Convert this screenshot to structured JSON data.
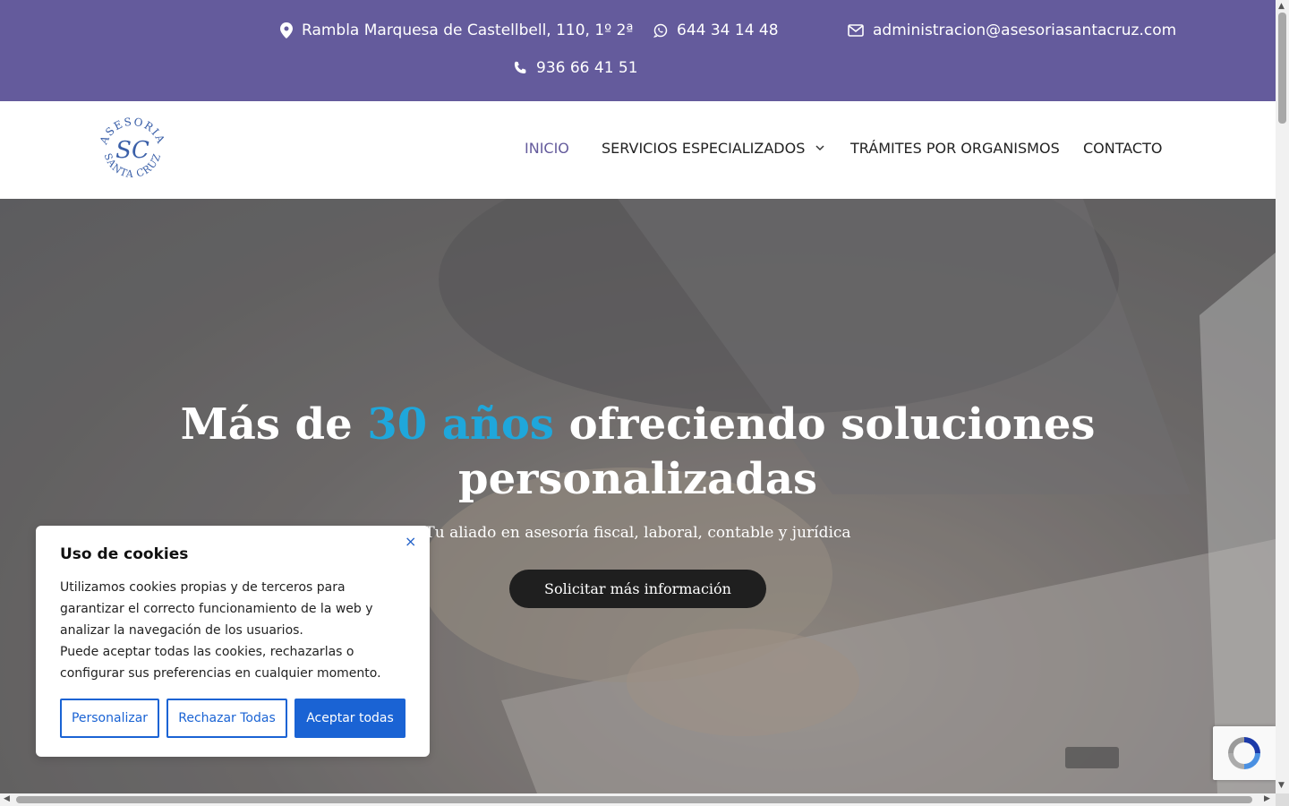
{
  "topbar": {
    "address": "Rambla Marquesa de Castellbell, 110, 1º 2ª",
    "whatsapp": "644 34 14 48",
    "email": "administracion@asesoriasantacruz.com",
    "phone": "936 66 41 51"
  },
  "logo": {
    "top_text": "ASESORIA",
    "monogram": "SC",
    "bottom_text": "SANTA CRUZ"
  },
  "nav": {
    "items": [
      "INICIO",
      "SERVICIOS ESPECIALIZADOS",
      "TRÁMITES POR ORGANISMOS",
      "CONTACTO"
    ],
    "active_color": "#645b9c"
  },
  "hero": {
    "title_part1": "Más de ",
    "title_accent": "30 años",
    "title_part2": " ofreciendo soluciones",
    "title_line2": "personalizadas",
    "subtitle": "Tu aliado en asesoría fiscal, laboral, contable y jurídica",
    "cta": "Solicitar más información",
    "accent_color": "#1fa7db"
  },
  "cookie": {
    "title": "Uso de cookies",
    "close": "×",
    "text1": "Utilizamos cookies propias y de terceros para garantizar el correcto funcionamiento de la web y analizar la navegación de los usuarios.",
    "text2": "Puede aceptar todas las cookies, rechazarlas o configurar sus preferencias en cualquier momento.",
    "btn_customize": "Personalizar",
    "btn_reject": "Rechazar Todas",
    "btn_accept": "Aceptar todas",
    "button_color": "#1a63d4"
  },
  "colors": {
    "topbar_bg": "#645b9c",
    "cta_bg": "#1f1f1f"
  }
}
